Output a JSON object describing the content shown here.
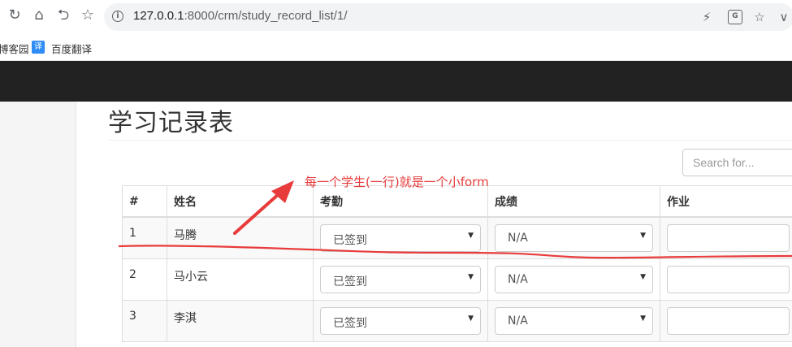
{
  "browser": {
    "url_host": "127.0.0.1",
    "url_rest": ":8000/crm/study_record_list/1/",
    "bookmarks": [
      {
        "label": "博客园",
        "icon": "cnblogs-icon"
      },
      {
        "label": "百度翻译",
        "icon": "baidu-translate-icon",
        "icon_text": "译",
        "icon_color": "#2f8cf6"
      }
    ]
  },
  "page": {
    "title": "学习记录表",
    "search_placeholder": "Search for..."
  },
  "table": {
    "headers": [
      "#",
      "姓名",
      "考勤",
      "成绩",
      "作业"
    ],
    "rows": [
      {
        "id": "1",
        "name": "马腾",
        "attendance": "已签到",
        "score": "N/A",
        "homework": ""
      },
      {
        "id": "2",
        "name": "马小云",
        "attendance": "已签到",
        "score": "N/A",
        "homework": ""
      },
      {
        "id": "3",
        "name": "李淇",
        "attendance": "已签到",
        "score": "N/A",
        "homework": ""
      }
    ]
  },
  "annotation": {
    "text": "每一个学生(一行)就是一个小form",
    "color": "#e83b3b"
  },
  "colors": {
    "navbar": "#222222",
    "sidebar": "#f5f5f5"
  }
}
